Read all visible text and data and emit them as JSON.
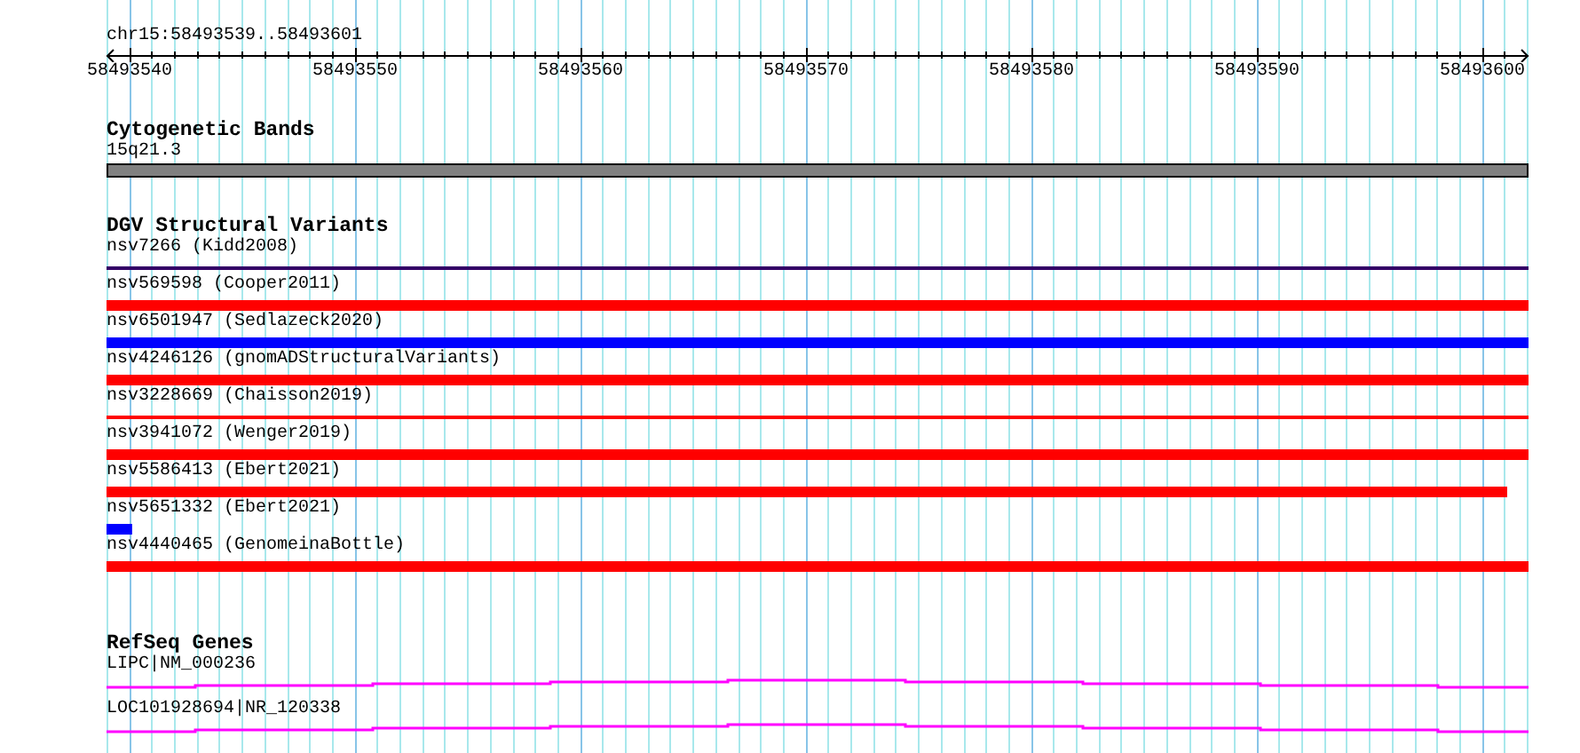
{
  "ruler": {
    "range": "chr15:58493539..58493601",
    "tick_labels": [
      "58493540",
      "58493550",
      "58493560",
      "58493570",
      "58493580",
      "58493590",
      "58493600"
    ]
  },
  "tracks": [
    {
      "title": "Cytogenetic Bands",
      "features": [
        {
          "label": "15q21.3",
          "kind": "band",
          "color": "#808080"
        }
      ]
    },
    {
      "title": "DGV Structural Variants",
      "features": [
        {
          "label": "nsv7266 (Kidd2008)",
          "kind": "line",
          "color": "#330066"
        },
        {
          "label": "nsv569598 (Cooper2011)",
          "kind": "bar",
          "color": "#ff0000"
        },
        {
          "label": "nsv6501947 (Sedlazeck2020)",
          "kind": "bar",
          "color": "#0000ff"
        },
        {
          "label": "nsv4246126 (gnomADStructuralVariants)",
          "kind": "bar",
          "color": "#ff0000"
        },
        {
          "label": "nsv3228669 (Chaisson2019)",
          "kind": "line",
          "color": "#ff0000"
        },
        {
          "label": "nsv3941072 (Wenger2019)",
          "kind": "bar",
          "color": "#ff0000"
        },
        {
          "label": "nsv5586413 (Ebert2021)",
          "kind": "bar",
          "color": "#ff0000",
          "level": 0.985
        },
        {
          "label": "nsv5651332 (Ebert2021)",
          "kind": "bar",
          "color": "#0000ff",
          "level": 0.018
        },
        {
          "label": "nsv4440465 (GenomeinaBottle)",
          "kind": "bar",
          "color": "#ff0000"
        }
      ]
    },
    {
      "title": "RefSeq Genes",
      "features": [
        {
          "label": "LIPC|NM_000236",
          "kind": "gene",
          "color": "#ff00ff"
        },
        {
          "label": "LOC101928694|NR_120338",
          "kind": "gene",
          "color": "#ff00ff"
        }
      ]
    }
  ]
}
